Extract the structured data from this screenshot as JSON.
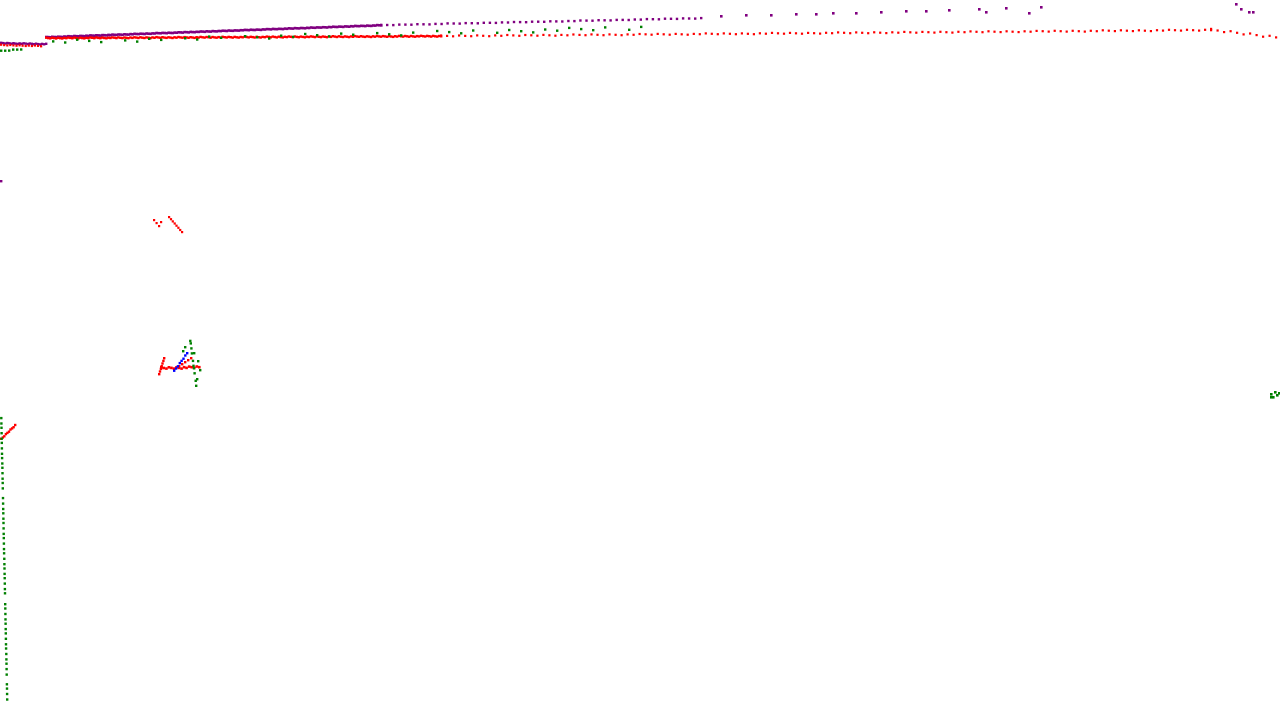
{
  "view": {
    "background": "#ffffff"
  },
  "point_layers": [
    {
      "name": "purple-points",
      "color": "#800080"
    },
    {
      "name": "red-points",
      "color": "#ff0000"
    },
    {
      "name": "green-points",
      "color": "#008000"
    },
    {
      "name": "blue-points",
      "color": "#0000ff"
    }
  ]
}
